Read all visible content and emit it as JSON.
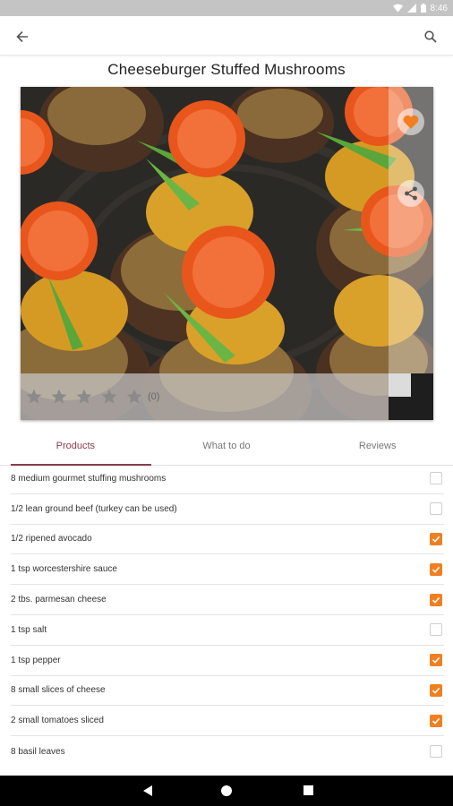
{
  "status_bar": {
    "time": "8:46",
    "icons": [
      "wifi-icon",
      "signal-icon",
      "battery-icon"
    ]
  },
  "app_bar": {
    "back_icon": "arrow-left-icon",
    "search_icon": "search-icon"
  },
  "recipe": {
    "title": "Cheeseburger Stuffed Mushrooms",
    "rating": {
      "value": 0,
      "max": 5,
      "count_label": "(0)"
    },
    "favorite": true
  },
  "colors": {
    "accent": "#f07f22",
    "tab_active": "#8a3c4e",
    "status_bar": "#c4c4c4"
  },
  "tabs": [
    {
      "label": "Products",
      "active": true
    },
    {
      "label": "What to do",
      "active": false
    },
    {
      "label": "Reviews",
      "active": false
    }
  ],
  "ingredients": [
    {
      "label": "8 medium gourmet stuffing mushrooms",
      "checked": false
    },
    {
      "label": "1/2 lean ground beef (turkey can be used)",
      "checked": false
    },
    {
      "label": "1/2 ripened avocado",
      "checked": true
    },
    {
      "label": "1 tsp worcestershire sauce",
      "checked": true
    },
    {
      "label": "2 tbs. parmesan cheese",
      "checked": true
    },
    {
      "label": "1 tsp salt",
      "checked": false
    },
    {
      "label": "1 tsp pepper",
      "checked": true
    },
    {
      "label": "8 small slices of cheese",
      "checked": true
    },
    {
      "label": "2 small tomatoes sliced",
      "checked": true
    },
    {
      "label": "8 basil leaves",
      "checked": false
    }
  ]
}
